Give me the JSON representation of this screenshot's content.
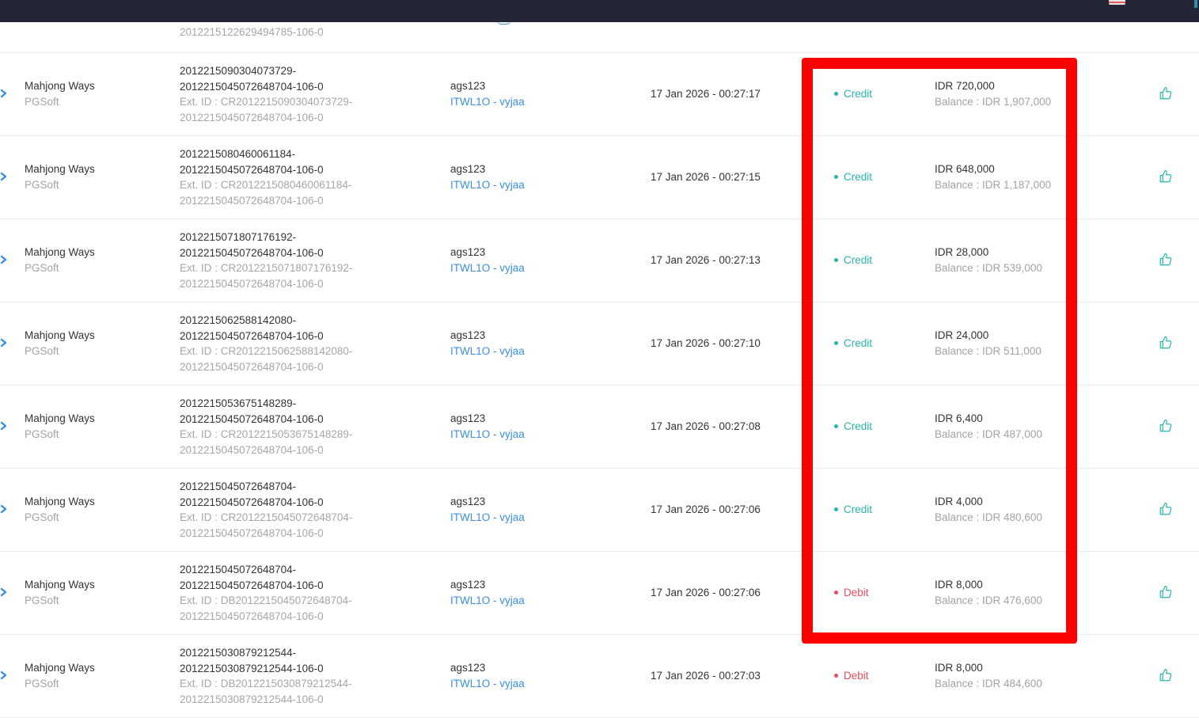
{
  "colors": {
    "topbar": "#242636",
    "credit": "#26b5ae",
    "debit": "#ec4a5c",
    "link": "#3a8ee6",
    "highlight": "#ff0000"
  },
  "partial_row": {
    "ext_tail": "2012215122629494785-106-0"
  },
  "rows": [
    {
      "game": "Mahjong Ways",
      "provider": "PGSoft",
      "txn_line1": "2012215090304073729-",
      "txn_line2": "2012215045072648704-106-0",
      "ext_line1": "Ext. ID : CR2012215090304073729-",
      "ext_line2": "2012215045072648704-106-0",
      "username": "ags123",
      "agent": "ITWL1O - vyjaa",
      "datetime": "17 Jan 2026 - 00:27:17",
      "type": "Credit",
      "amount": "IDR 720,000",
      "balance": "Balance : IDR 1,907,000"
    },
    {
      "game": "Mahjong Ways",
      "provider": "PGSoft",
      "txn_line1": "2012215080460061184-",
      "txn_line2": "2012215045072648704-106-0",
      "ext_line1": "Ext. ID : CR2012215080460061184-",
      "ext_line2": "2012215045072648704-106-0",
      "username": "ags123",
      "agent": "ITWL1O - vyjaa",
      "datetime": "17 Jan 2026 - 00:27:15",
      "type": "Credit",
      "amount": "IDR 648,000",
      "balance": "Balance : IDR 1,187,000"
    },
    {
      "game": "Mahjong Ways",
      "provider": "PGSoft",
      "txn_line1": "2012215071807176192-",
      "txn_line2": "2012215045072648704-106-0",
      "ext_line1": "Ext. ID : CR2012215071807176192-",
      "ext_line2": "2012215045072648704-106-0",
      "username": "ags123",
      "agent": "ITWL1O - vyjaa",
      "datetime": "17 Jan 2026 - 00:27:13",
      "type": "Credit",
      "amount": "IDR 28,000",
      "balance": "Balance : IDR 539,000"
    },
    {
      "game": "Mahjong Ways",
      "provider": "PGSoft",
      "txn_line1": "2012215062588142080-",
      "txn_line2": "2012215045072648704-106-0",
      "ext_line1": "Ext. ID : CR2012215062588142080-",
      "ext_line2": "2012215045072648704-106-0",
      "username": "ags123",
      "agent": "ITWL1O - vyjaa",
      "datetime": "17 Jan 2026 - 00:27:10",
      "type": "Credit",
      "amount": "IDR 24,000",
      "balance": "Balance : IDR 511,000"
    },
    {
      "game": "Mahjong Ways",
      "provider": "PGSoft",
      "txn_line1": "2012215053675148289-",
      "txn_line2": "2012215045072648704-106-0",
      "ext_line1": "Ext. ID : CR2012215053675148289-",
      "ext_line2": "2012215045072648704-106-0",
      "username": "ags123",
      "agent": "ITWL1O - vyjaa",
      "datetime": "17 Jan 2026 - 00:27:08",
      "type": "Credit",
      "amount": "IDR 6,400",
      "balance": "Balance : IDR 487,000"
    },
    {
      "game": "Mahjong Ways",
      "provider": "PGSoft",
      "txn_line1": "2012215045072648704-",
      "txn_line2": "2012215045072648704-106-0",
      "ext_line1": "Ext. ID : CR2012215045072648704-",
      "ext_line2": "2012215045072648704-106-0",
      "username": "ags123",
      "agent": "ITWL1O - vyjaa",
      "datetime": "17 Jan 2026 - 00:27:06",
      "type": "Credit",
      "amount": "IDR 4,000",
      "balance": "Balance : IDR 480,600"
    },
    {
      "game": "Mahjong Ways",
      "provider": "PGSoft",
      "txn_line1": "2012215045072648704-",
      "txn_line2": "2012215045072648704-106-0",
      "ext_line1": "Ext. ID : DB2012215045072648704-",
      "ext_line2": "2012215045072648704-106-0",
      "username": "ags123",
      "agent": "ITWL1O - vyjaa",
      "datetime": "17 Jan 2026 - 00:27:06",
      "type": "Debit",
      "amount": "IDR 8,000",
      "balance": "Balance : IDR 476,600"
    },
    {
      "game": "Mahjong Ways",
      "provider": "PGSoft",
      "txn_line1": "2012215030879212544-",
      "txn_line2": "2012215030879212544-106-0",
      "ext_line1": "Ext. ID : DB2012215030879212544-",
      "ext_line2": "2012215030879212544-106-0",
      "username": "ags123",
      "agent": "ITWL1O - vyjaa",
      "datetime": "17 Jan 2026 - 00:27:03",
      "type": "Debit",
      "amount": "IDR 8,000",
      "balance": "Balance : IDR 484,600"
    }
  ]
}
